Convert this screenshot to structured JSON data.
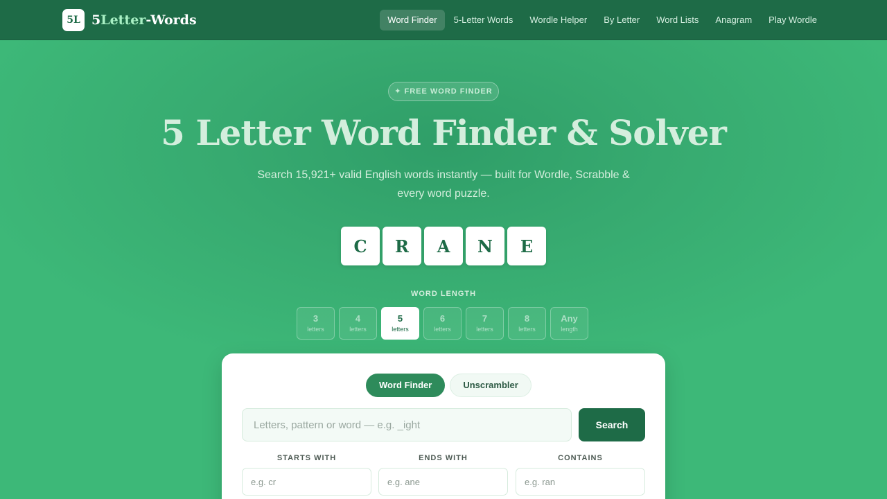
{
  "brand": {
    "logo": "5L",
    "name_prefix": "5",
    "name_highlight": "Letter",
    "name_suffix": "-Words"
  },
  "nav": [
    {
      "label": "Word Finder",
      "active": true
    },
    {
      "label": "5-Letter Words"
    },
    {
      "label": "Wordle Helper"
    },
    {
      "label": "By Letter"
    },
    {
      "label": "Word Lists"
    },
    {
      "label": "Anagram"
    },
    {
      "label": "Play Wordle"
    }
  ],
  "hero": {
    "badge": "✦ FREE WORD FINDER",
    "title": "5 Letter Word Finder & Solver",
    "subtitle": "Search 15,921+ valid English words instantly — built for Wordle, Scrabble & every word puzzle.",
    "tiles": [
      "C",
      "R",
      "A",
      "N",
      "E"
    ]
  },
  "word_length": {
    "label": "WORD LENGTH",
    "options": [
      {
        "n": "3",
        "sub": "letters"
      },
      {
        "n": "4",
        "sub": "letters"
      },
      {
        "n": "5",
        "sub": "letters",
        "active": true
      },
      {
        "n": "6",
        "sub": "letters"
      },
      {
        "n": "7",
        "sub": "letters"
      },
      {
        "n": "8",
        "sub": "letters"
      },
      {
        "n": "Any",
        "sub": "length"
      }
    ]
  },
  "card": {
    "modes": [
      {
        "label": "Word Finder",
        "active": true
      },
      {
        "label": "Unscrambler"
      }
    ],
    "search_placeholder": "Letters, pattern or word — e.g. _ight",
    "search_button": "Search",
    "starts_with": {
      "label": "STARTS WITH",
      "placeholder": "e.g. cr"
    },
    "ends_with": {
      "label": "ENDS WITH",
      "placeholder": "e.g. ane"
    },
    "contains": {
      "label": "CONTAINS",
      "placeholder": "e.g. ran"
    }
  },
  "colors": {
    "nav_bg": "#1e6b47",
    "hero_bg": "#3db878",
    "accent": "#2e8b5b"
  }
}
